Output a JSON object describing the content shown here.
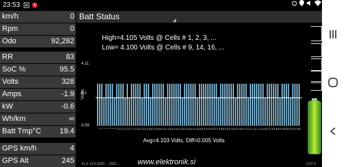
{
  "status_bar": {
    "time": "23:53"
  },
  "left_rows": [
    {
      "label": "km/h",
      "value": "0"
    },
    {
      "label": "Rpm",
      "value": "0"
    },
    {
      "label": "Odo",
      "value": "92,282"
    },
    {
      "label": "RR",
      "value": "83"
    },
    {
      "label": "SoC %",
      "value": "95.5"
    },
    {
      "label": "Volts",
      "value": "328"
    },
    {
      "label": "Amps",
      "value": "-1.9"
    },
    {
      "label": "kW",
      "value": "-0.6"
    },
    {
      "label": "Wh/km",
      "value": "∞"
    },
    {
      "label": "Batt Tmp°C",
      "value": "19.4"
    },
    {
      "label": "GPS km/h",
      "value": "4"
    },
    {
      "label": "GPS Alt",
      "value": "245"
    }
  ],
  "panel": {
    "title": "Batt Status"
  },
  "chart_data": {
    "type": "bar",
    "title": "",
    "annotations": {
      "high": "High=4.105 Volts @ Cells # 1, 2, 3,  ...",
      "low": "Low= 4.100 Volts @ Cells # 9, 14, 16,  ...",
      "summary": "Avg=4.103 Volts, Diff=0.005 Volts"
    },
    "ylabel": "Volts",
    "yticks": [
      "4.11",
      "4.1",
      "4.09"
    ],
    "ylim": [
      4.09,
      4.115
    ],
    "cells": 96,
    "values": [
      4.105,
      4.105,
      4.105,
      4.1,
      4.105,
      4.105,
      4.105,
      4.105,
      4.1,
      4.105,
      4.105,
      4.105,
      4.105,
      4.1,
      4.105,
      4.1,
      4.105,
      4.105,
      4.105,
      4.105,
      4.105,
      4.1,
      4.105,
      4.105,
      4.105,
      4.1,
      4.105,
      4.105,
      4.105,
      4.105,
      4.105,
      4.105,
      4.1,
      4.105,
      4.105,
      4.105,
      4.105,
      4.105,
      4.105,
      4.105,
      4.1,
      4.105,
      4.105,
      4.105,
      4.105,
      4.105,
      4.105,
      4.1,
      4.105,
      4.105,
      4.105,
      4.105,
      4.105,
      4.105,
      4.105,
      4.105,
      4.105,
      4.1,
      4.105,
      4.105,
      4.105,
      4.105,
      4.105,
      4.105,
      4.105,
      4.1,
      4.105,
      4.105,
      4.105,
      4.105,
      4.105,
      4.1,
      4.105,
      4.105,
      4.105,
      4.105,
      4.105,
      4.105,
      4.105,
      4.1,
      4.105,
      4.105,
      4.105,
      4.105,
      4.105,
      4.105,
      4.1,
      4.105,
      4.105,
      4.105,
      4.105,
      4.1,
      4.105,
      4.105,
      4.105,
      4.105
    ],
    "bar_color": "#8cc7e8",
    "ref_line_value": 4.1
  },
  "watermark": "www.elektronik.si",
  "bottom_left_text": "V1.0 14.2.2020 ... 2021 ...",
  "bottom_right_text": "1.07 V"
}
